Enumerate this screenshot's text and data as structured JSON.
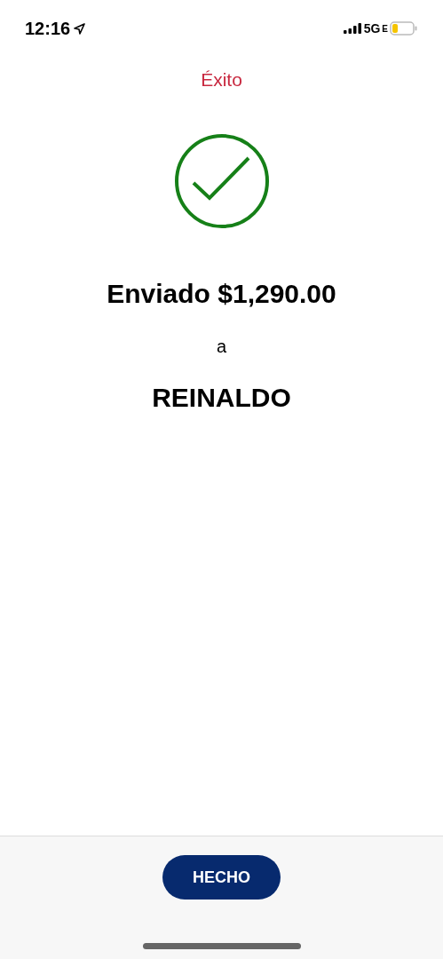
{
  "status_bar": {
    "time": "12:16",
    "network": "5G",
    "network_suffix": "E"
  },
  "title": "Éxito",
  "headline": "Enviado $1,290.00",
  "connector": "a",
  "recipient": "REINALDO",
  "button": {
    "label": "HECHO"
  }
}
